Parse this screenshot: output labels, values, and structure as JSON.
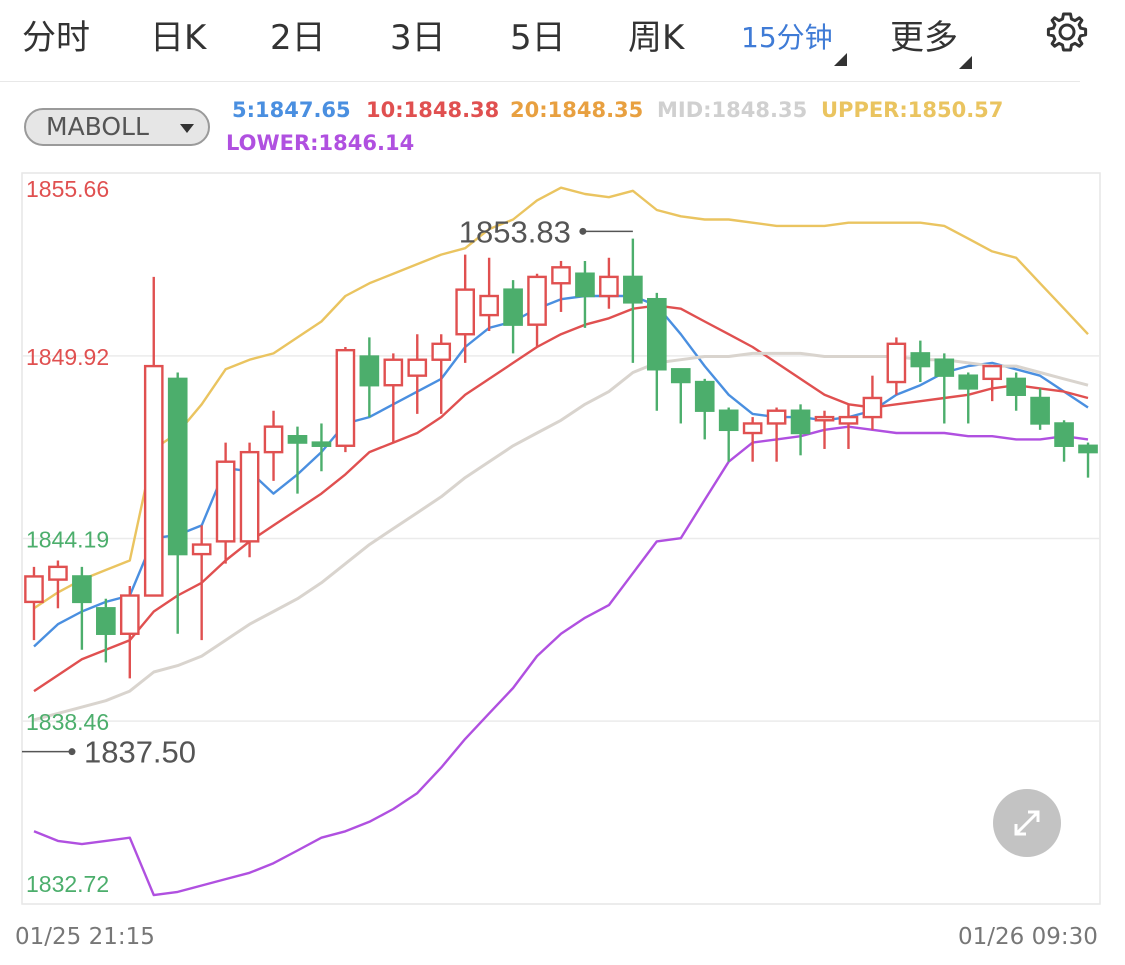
{
  "tabs": [
    {
      "label": "分时",
      "name": "tab-fenshi",
      "active": false
    },
    {
      "label": "日K",
      "name": "tab-daily-k",
      "active": false
    },
    {
      "label": "2日",
      "name": "tab-2day",
      "active": false
    },
    {
      "label": "3日",
      "name": "tab-3day",
      "active": false
    },
    {
      "label": "5日",
      "name": "tab-5day",
      "active": false
    },
    {
      "label": "周K",
      "name": "tab-weekly-k",
      "active": false
    },
    {
      "label": "15分钟",
      "name": "tab-15min",
      "active": true,
      "has_menu": true
    },
    {
      "label": "更多",
      "name": "tab-more",
      "active": false,
      "has_menu": true
    }
  ],
  "indicator": {
    "selected": "MABOLL",
    "legend": [
      {
        "text": "5:1847.65",
        "color": "#4a8fe0"
      },
      {
        "text": "10:1848.38",
        "color": "#e05050"
      },
      {
        "text": "20:1848.35",
        "color": "#e8a040"
      },
      {
        "text": "MID:1848.35",
        "color": "#d0d0d0"
      },
      {
        "text": "UPPER:1850.57",
        "color": "#eac460"
      },
      {
        "text": "LOWER:1846.14",
        "color": "#b050e0"
      }
    ]
  },
  "icons": {
    "settings": "gear-icon",
    "expand": "expand-arrows-icon",
    "dropdown": "caret-down-icon"
  },
  "colors": {
    "up": "#e05050",
    "down": "#4cae6c",
    "ma5": "#4a8fe0",
    "ma10": "#e05050",
    "mid": "#d9d4ce",
    "upper": "#eac460",
    "lower": "#b050e0"
  },
  "chart_data": {
    "type": "candlestick",
    "ylim": [
      1832.72,
      1855.66
    ],
    "y_ticks": [
      {
        "label": "1855.66",
        "value": 1855.66,
        "color": "#e05050"
      },
      {
        "label": "1849.92",
        "value": 1849.92,
        "color": "#e05050"
      },
      {
        "label": "1844.19",
        "value": 1844.19,
        "color": "#4cae6c"
      },
      {
        "label": "1838.46",
        "value": 1838.46,
        "color": "#4cae6c"
      },
      {
        "label": "1832.72",
        "value": 1832.72,
        "color": "#4cae6c"
      }
    ],
    "x_start": "01/25 21:15",
    "x_end": "01/26 09:30",
    "max_marker": {
      "label": "1853.83",
      "value": 1853.83,
      "index": 25
    },
    "min_marker": {
      "label": "1837.50",
      "value": 1837.5,
      "index": 0
    },
    "candles": [
      [
        1842.2,
        1843.0,
        1841.0,
        1843.3
      ],
      [
        1842.9,
        1843.3,
        1842.0,
        1843.5
      ],
      [
        1843.0,
        1842.2,
        1840.7,
        1843.3
      ],
      [
        1842.0,
        1841.2,
        1840.3,
        1842.3
      ],
      [
        1841.2,
        1842.4,
        1839.8,
        1842.7
      ],
      [
        1842.4,
        1849.6,
        1842.4,
        1852.4
      ],
      [
        1849.2,
        1843.7,
        1841.2,
        1849.4
      ],
      [
        1843.7,
        1844.0,
        1841.0,
        1844.6
      ],
      [
        1844.1,
        1846.6,
        1843.4,
        1847.2
      ],
      [
        1844.1,
        1846.9,
        1843.6,
        1847.2
      ],
      [
        1846.9,
        1847.7,
        1846.0,
        1848.2
      ],
      [
        1847.4,
        1847.2,
        1845.6,
        1847.7
      ],
      [
        1847.2,
        1847.1,
        1846.3,
        1847.8
      ],
      [
        1847.1,
        1850.1,
        1846.9,
        1850.2
      ],
      [
        1849.9,
        1849.0,
        1848.0,
        1850.5
      ],
      [
        1849.0,
        1849.8,
        1847.2,
        1850.0
      ],
      [
        1849.3,
        1849.8,
        1848.1,
        1850.6
      ],
      [
        1849.8,
        1850.3,
        1848.1,
        1850.6
      ],
      [
        1850.6,
        1852.0,
        1849.7,
        1853.1
      ],
      [
        1851.2,
        1851.8,
        1850.7,
        1853.0
      ],
      [
        1852.0,
        1850.9,
        1850.0,
        1852.3
      ],
      [
        1850.9,
        1852.4,
        1850.2,
        1852.5
      ],
      [
        1852.2,
        1852.7,
        1851.3,
        1852.9
      ],
      [
        1852.5,
        1851.8,
        1850.8,
        1852.9
      ],
      [
        1851.8,
        1852.4,
        1851.4,
        1853.0
      ],
      [
        1852.4,
        1851.6,
        1849.7,
        1853.6
      ],
      [
        1851.7,
        1849.5,
        1848.2,
        1851.9
      ],
      [
        1849.5,
        1849.1,
        1847.8,
        1849.3
      ],
      [
        1849.1,
        1848.2,
        1847.3,
        1849.2
      ],
      [
        1848.2,
        1847.6,
        1846.6,
        1848.3
      ],
      [
        1847.5,
        1847.8,
        1846.6,
        1848.0
      ],
      [
        1847.8,
        1848.2,
        1846.6,
        1848.3
      ],
      [
        1848.2,
        1847.5,
        1846.8,
        1848.4
      ],
      [
        1847.9,
        1848.0,
        1847.0,
        1848.2
      ],
      [
        1847.8,
        1848.0,
        1847.0,
        1848.4
      ],
      [
        1848.0,
        1848.6,
        1847.6,
        1849.3
      ],
      [
        1849.1,
        1850.3,
        1848.7,
        1850.5
      ],
      [
        1850.0,
        1849.6,
        1849.1,
        1850.4
      ],
      [
        1849.8,
        1849.3,
        1847.8,
        1850.0
      ],
      [
        1849.3,
        1848.9,
        1847.8,
        1849.4
      ],
      [
        1849.2,
        1849.6,
        1848.5,
        1849.6
      ],
      [
        1849.2,
        1848.7,
        1848.2,
        1849.4
      ],
      [
        1848.6,
        1847.8,
        1847.6,
        1848.9
      ],
      [
        1847.8,
        1847.1,
        1846.6,
        1847.9
      ],
      [
        1847.1,
        1846.9,
        1846.1,
        1847.2
      ]
    ],
    "series": [
      {
        "name": "5",
        "values": [
          1840.8,
          1841.5,
          1841.9,
          1842.2,
          1842.4,
          1844.2,
          1844.3,
          1844.6,
          1846.4,
          1846.3,
          1845.6,
          1846.2,
          1846.9,
          1847.8,
          1848.0,
          1848.4,
          1848.8,
          1849.2,
          1850.2,
          1850.8,
          1851.0,
          1851.4,
          1851.7,
          1851.8,
          1851.8,
          1851.8,
          1851.5,
          1850.6,
          1849.6,
          1848.7,
          1848.1,
          1848.0,
          1848.0,
          1847.9,
          1848.0,
          1848.2,
          1848.7,
          1849.0,
          1849.4,
          1849.6,
          1849.7,
          1849.5,
          1849.3,
          1848.8,
          1848.3
        ]
      },
      {
        "name": "10",
        "values": [
          1839.4,
          1839.9,
          1840.4,
          1840.7,
          1841.0,
          1841.9,
          1842.4,
          1842.8,
          1843.5,
          1844.1,
          1844.6,
          1845.1,
          1845.6,
          1846.2,
          1846.9,
          1847.2,
          1847.5,
          1848.0,
          1848.7,
          1849.2,
          1849.7,
          1850.2,
          1850.6,
          1850.9,
          1851.1,
          1851.4,
          1851.5,
          1851.4,
          1851.0,
          1850.6,
          1850.2,
          1849.7,
          1849.2,
          1848.7,
          1848.4,
          1848.3,
          1848.4,
          1848.5,
          1848.6,
          1848.7,
          1848.9,
          1849.0,
          1848.9,
          1848.8,
          1848.6
        ]
      },
      {
        "name": "MID",
        "values": [
          1838.5,
          1838.7,
          1838.9,
          1839.1,
          1839.4,
          1840.0,
          1840.2,
          1840.5,
          1841.0,
          1841.5,
          1841.9,
          1842.3,
          1842.8,
          1843.4,
          1844.0,
          1844.5,
          1845.0,
          1845.5,
          1846.1,
          1846.6,
          1847.1,
          1847.5,
          1847.9,
          1848.4,
          1848.8,
          1849.4,
          1849.7,
          1849.8,
          1849.9,
          1849.9,
          1850.0,
          1850.0,
          1850.0,
          1849.9,
          1849.9,
          1849.9,
          1849.9,
          1849.8,
          1849.8,
          1849.7,
          1849.6,
          1849.6,
          1849.4,
          1849.2,
          1849.0
        ]
      },
      {
        "name": "UPPER",
        "values": [
          1842.0,
          1842.5,
          1842.9,
          1843.2,
          1843.5,
          1847.0,
          1847.5,
          1848.4,
          1849.5,
          1849.8,
          1850.0,
          1850.5,
          1851.0,
          1851.8,
          1852.2,
          1852.5,
          1852.8,
          1853.1,
          1853.3,
          1853.9,
          1854.2,
          1854.8,
          1855.2,
          1855.0,
          1854.9,
          1855.1,
          1854.5,
          1854.3,
          1854.2,
          1854.2,
          1854.1,
          1854.0,
          1854.0,
          1854.0,
          1854.1,
          1854.1,
          1854.1,
          1854.1,
          1854.0,
          1853.6,
          1853.2,
          1853.0,
          1852.2,
          1851.4,
          1850.6
        ]
      },
      {
        "name": "LOWER",
        "values": [
          1835.0,
          1834.7,
          1834.6,
          1834.7,
          1834.8,
          1833.0,
          1833.1,
          1833.3,
          1833.5,
          1833.7,
          1834.0,
          1834.4,
          1834.8,
          1835.0,
          1835.3,
          1835.7,
          1836.2,
          1837.0,
          1837.9,
          1838.7,
          1839.5,
          1840.5,
          1841.2,
          1841.7,
          1842.1,
          1843.1,
          1844.1,
          1844.2,
          1845.4,
          1846.6,
          1847.2,
          1847.3,
          1847.4,
          1847.6,
          1847.7,
          1847.6,
          1847.5,
          1847.5,
          1847.5,
          1847.4,
          1847.4,
          1847.3,
          1847.3,
          1847.4,
          1847.3
        ]
      }
    ]
  }
}
